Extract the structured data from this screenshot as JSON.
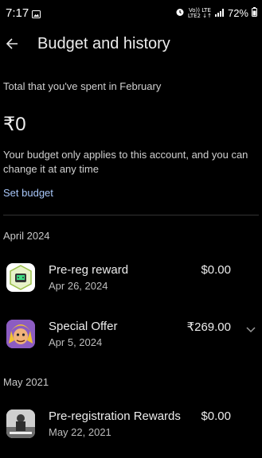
{
  "status": {
    "time": "7:17",
    "network_top": "Vo)) LTE",
    "network_bottom": "LTE2 ↓↑",
    "battery": "72%"
  },
  "header": {
    "title": "Budget and history"
  },
  "summary": {
    "spent_label": "Total that you've spent in February",
    "spent_amount": "₹0",
    "note": "Your budget only applies to this account, and you can change it at any time",
    "set_budget": "Set budget"
  },
  "sections": [
    {
      "label": "April 2024",
      "items": [
        {
          "title": "Pre-reg reward",
          "date": "Apr 26, 2024",
          "price": "$0.00",
          "icon": "android-reward-icon"
        },
        {
          "title": "Special Offer",
          "date": "Apr 5, 2024",
          "price": "₹269.00",
          "icon": "clash-game-icon"
        }
      ]
    },
    {
      "label": "May 2021",
      "items": [
        {
          "title": "Pre-registration Rewards",
          "date": "May 22, 2021",
          "price": "$0.00",
          "icon": "battlegrounds-game-icon"
        }
      ]
    }
  ]
}
